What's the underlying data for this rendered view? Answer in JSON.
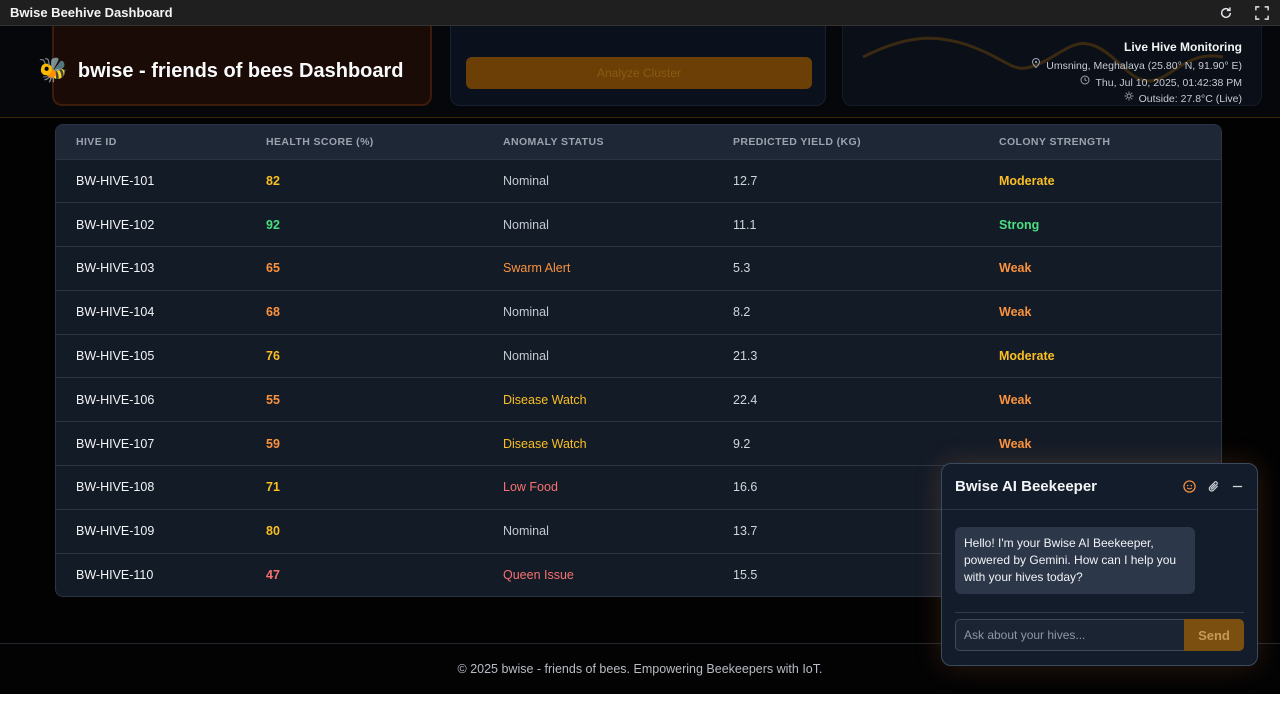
{
  "window": {
    "title": "Bwise Beehive Dashboard"
  },
  "header": {
    "brand_emoji": "🐝",
    "title": "bwise - friends of bees Dashboard",
    "ghost_button": "Analyze Cluster",
    "live": {
      "title": "Live Hive Monitoring",
      "location": "Umsning, Meghalaya (25.80° N, 91.90° E)",
      "datetime": "Thu, Jul 10, 2025, 01:42:38 PM",
      "outside": "Outside: 27.8°C (Live)"
    }
  },
  "table": {
    "headers": [
      "HIVE ID",
      "HEALTH SCORE (%)",
      "ANOMALY STATUS",
      "PREDICTED YIELD (KG)",
      "COLONY STRENGTH"
    ],
    "rows": [
      {
        "id": "BW-HIVE-101",
        "health": "82",
        "status": "Nominal",
        "yield": "12.7",
        "strength": "Moderate"
      },
      {
        "id": "BW-HIVE-102",
        "health": "92",
        "status": "Nominal",
        "yield": "11.1",
        "strength": "Strong"
      },
      {
        "id": "BW-HIVE-103",
        "health": "65",
        "status": "Swarm Alert",
        "yield": "5.3",
        "strength": "Weak"
      },
      {
        "id": "BW-HIVE-104",
        "health": "68",
        "status": "Nominal",
        "yield": "8.2",
        "strength": "Weak"
      },
      {
        "id": "BW-HIVE-105",
        "health": "76",
        "status": "Nominal",
        "yield": "21.3",
        "strength": "Moderate"
      },
      {
        "id": "BW-HIVE-106",
        "health": "55",
        "status": "Disease Watch",
        "yield": "22.4",
        "strength": "Weak"
      },
      {
        "id": "BW-HIVE-107",
        "health": "59",
        "status": "Disease Watch",
        "yield": "9.2",
        "strength": "Weak"
      },
      {
        "id": "BW-HIVE-108",
        "health": "71",
        "status": "Low Food",
        "yield": "16.6",
        "strength": ""
      },
      {
        "id": "BW-HIVE-109",
        "health": "80",
        "status": "Nominal",
        "yield": "13.7",
        "strength": ""
      },
      {
        "id": "BW-HIVE-110",
        "health": "47",
        "status": "Queen Issue",
        "yield": "15.5",
        "strength": ""
      }
    ]
  },
  "colors": {
    "health": {
      "82": "c-amber",
      "92": "c-green",
      "65": "c-orange",
      "68": "c-orange",
      "76": "c-amber",
      "55": "c-orange",
      "59": "c-orange",
      "71": "c-amber",
      "80": "c-amber",
      "47": "c-red"
    },
    "status": {
      "Nominal": "s-nominal",
      "Swarm Alert": "s-orange",
      "Disease Watch": "s-amber",
      "Low Food": "s-red",
      "Queen Issue": "s-red"
    },
    "strength": {
      "Moderate": "c-amber",
      "Strong": "c-green",
      "Weak": "c-orange"
    },
    "accent": "#fb923c"
  },
  "chat": {
    "title": "Bwise AI Beekeeper",
    "message": "Hello! I'm your Bwise AI Beekeeper, powered by Gemini. How can I help you with your hives today?",
    "placeholder": "Ask about your hives...",
    "send_label": "Send"
  },
  "footer": {
    "text": "© 2025 bwise - friends of bees. Empowering Beekeepers with IoT."
  }
}
